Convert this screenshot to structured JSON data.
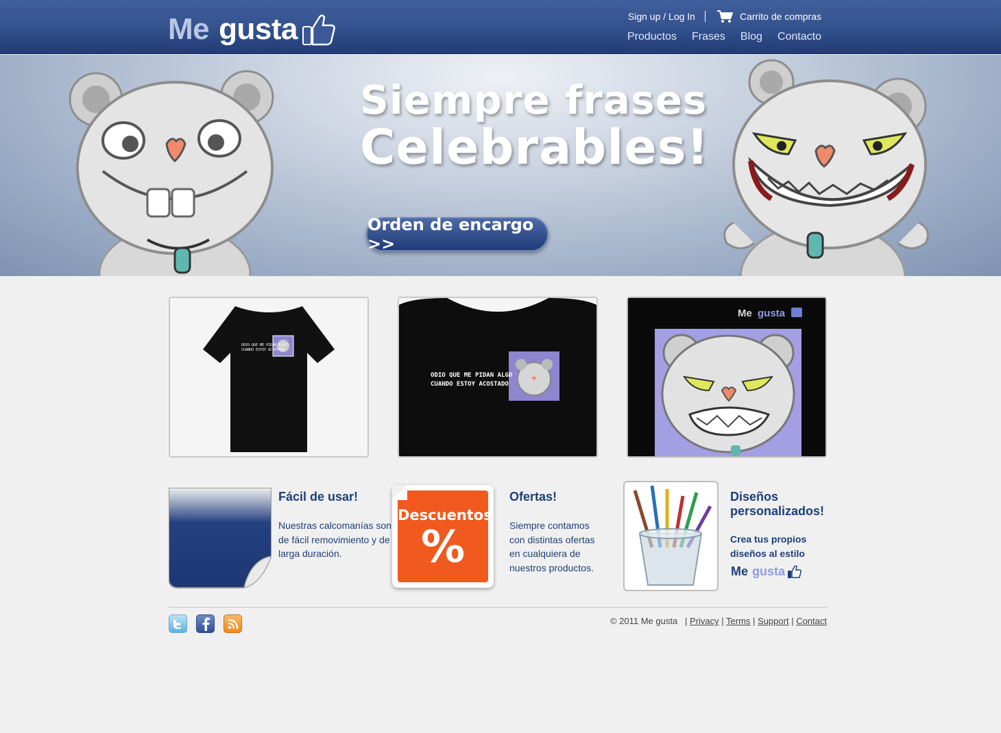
{
  "header": {
    "logo_me": "Me",
    "logo_gusta": "gusta",
    "signup": "Sign up / Log In",
    "cart": "Carrito de compras",
    "nav": [
      "Productos",
      "Frases",
      "Blog",
      "Contacto"
    ]
  },
  "hero": {
    "title_line1": "Siempre frases",
    "title_line2": "Celebrables!",
    "button": "Orden de encargo >>"
  },
  "products": {
    "shirt_text_line1": "ODIO QUE ME PIDAN ALGO",
    "shirt_text_line2": "CUANDO ESTOY ACOSTADO",
    "poster_logo_me": "Me",
    "poster_logo_gusta": "gusta"
  },
  "features": [
    {
      "title": "Fácil de usar!",
      "text": "Nuestras calcomanías son de fácil removimiento y de larga duración."
    },
    {
      "badge_label": "Descuentos",
      "badge_symbol": "%",
      "title": "Ofertas!",
      "text": "Siempre contamos con distintas ofertas en cualquiera de nuestros productos."
    },
    {
      "title": "Diseños personalizados!",
      "text": "Crea tus propios diseños al estilo",
      "logo_me": "Me",
      "logo_gusta": "gusta"
    }
  ],
  "footer": {
    "copyright": "© 2011   Me gusta",
    "links": [
      "Privacy",
      "Terms",
      "Support",
      "Contact"
    ],
    "social": [
      "twitter-icon",
      "facebook-icon",
      "rss-icon"
    ]
  },
  "colors": {
    "header_blue": "#34538f",
    "text_blue": "#1c3f7a",
    "orange": "#f05a1e"
  }
}
